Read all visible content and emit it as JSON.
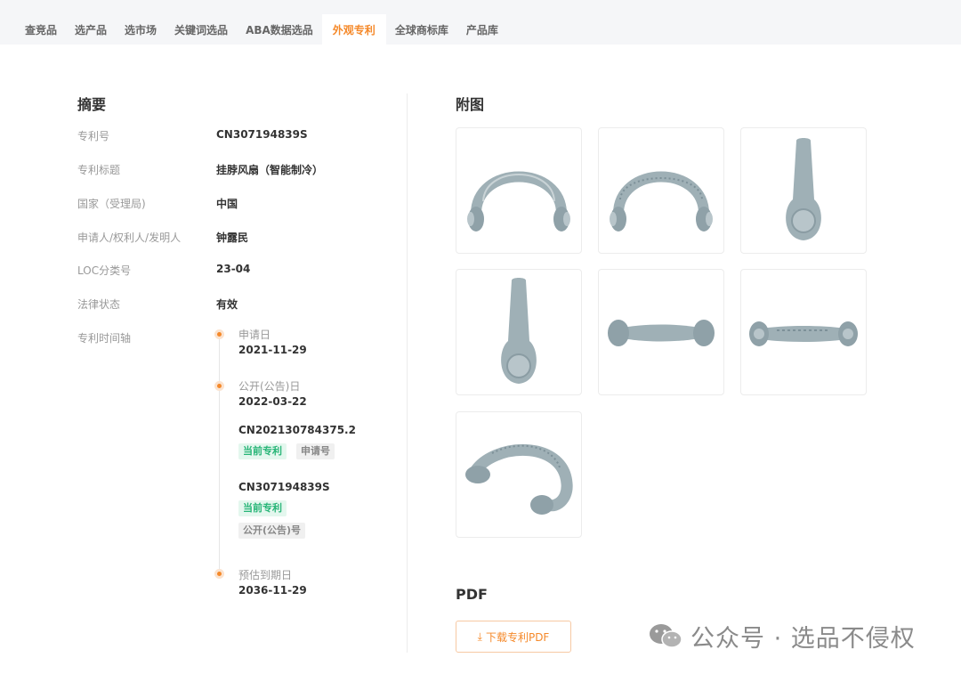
{
  "nav": {
    "tabs": [
      {
        "label": "查竞品"
      },
      {
        "label": "选产品"
      },
      {
        "label": "选市场"
      },
      {
        "label": "关键词选品"
      },
      {
        "label": "ABA数据选品"
      },
      {
        "label": "外观专利"
      },
      {
        "label": "全球商标库"
      },
      {
        "label": "产品库"
      }
    ],
    "active_index": 5
  },
  "summary": {
    "title": "摘要",
    "rows": [
      {
        "label": "专利号",
        "value": "CN307194839S"
      },
      {
        "label": "专利标题",
        "value": "挂脖风扇（智能制冷）"
      },
      {
        "label": "国家（受理局)",
        "value": "中国"
      },
      {
        "label": "申请人/权利人/发明人",
        "value": "钟露民"
      },
      {
        "label": "LOC分类号",
        "value": "23-04"
      },
      {
        "label": "法律状态",
        "value": "有效"
      },
      {
        "label": "专利时间轴",
        "value": ""
      }
    ],
    "timeline": {
      "apply": {
        "label": "申请日",
        "date": "2021-11-29"
      },
      "publish": {
        "label": "公开(公告)日",
        "date": "2022-03-22"
      },
      "numbers": [
        {
          "number": "CN202130784375.2",
          "tags": [
            "当前专利",
            "申请号"
          ]
        },
        {
          "number": "CN307194839S",
          "tags": [
            "当前专利",
            "公开(公告)号"
          ]
        }
      ],
      "expire": {
        "label": "预估到期日",
        "date": "2036-11-29"
      }
    }
  },
  "figures": {
    "title": "附图",
    "images": [
      {
        "icon": "neck-fan-front-view"
      },
      {
        "icon": "neck-fan-back-view"
      },
      {
        "icon": "neck-fan-left-view"
      },
      {
        "icon": "neck-fan-right-view"
      },
      {
        "icon": "neck-fan-top-view"
      },
      {
        "icon": "neck-fan-bottom-view"
      },
      {
        "icon": "neck-fan-perspective-view"
      }
    ]
  },
  "pdf": {
    "title": "PDF",
    "button_label": "下载专利PDF"
  },
  "watermark": {
    "text": "公众号 · 选品不侵权"
  },
  "colors": {
    "accent": "#f5892a",
    "tag_green": "#27b577",
    "product_gray": "#9fb0b6"
  }
}
